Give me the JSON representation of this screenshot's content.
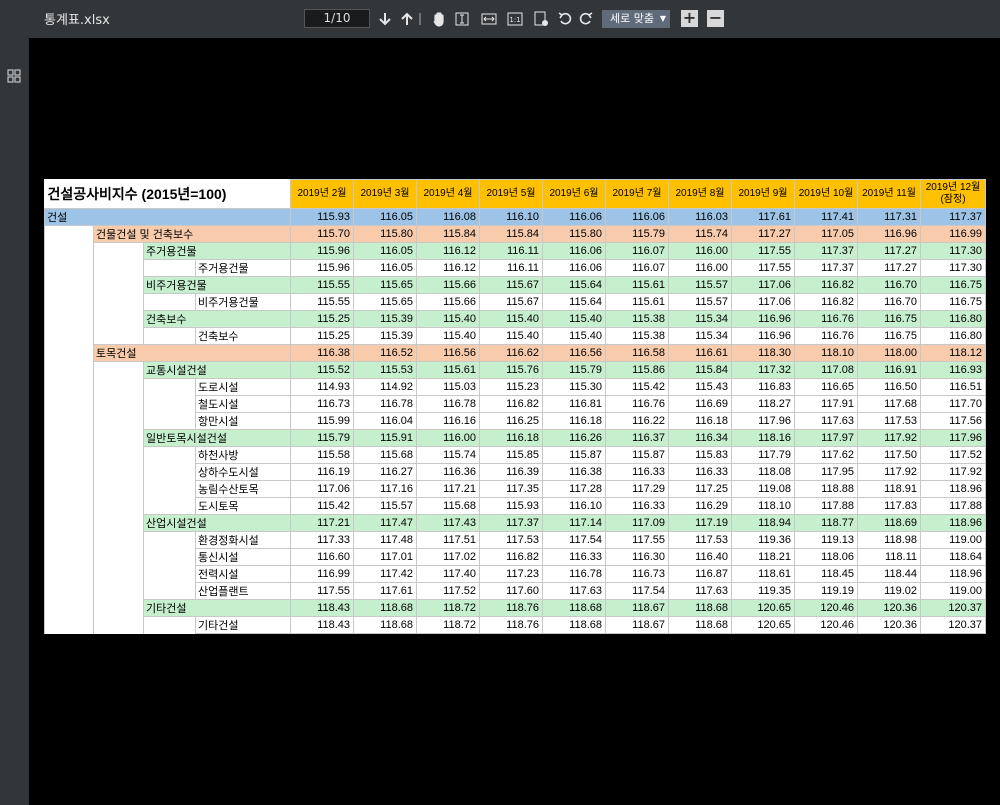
{
  "app": {
    "file_name": "통계표.xlsx",
    "page_indicator": "1/10",
    "fit_mode": "세로 맞춤",
    "zoom_in": "+",
    "zoom_out": "−"
  },
  "table": {
    "title": "건설공사비지수 (2015년=100)",
    "headers": [
      "2019년 2월",
      "2019년 3월",
      "2019년 4월",
      "2019년 5월",
      "2019년 6월",
      "2019년 7월",
      "2019년 8월",
      "2019년 9월",
      "2019년 10월",
      "2019년 11월",
      "2019년 12월",
      "(잠정)"
    ],
    "rows": [
      {
        "level": 0,
        "label": "건설",
        "values": [
          "115.93",
          "116.05",
          "116.08",
          "116.10",
          "116.06",
          "116.06",
          "116.03",
          "117.61",
          "117.41",
          "117.31",
          "117.37"
        ]
      },
      {
        "level": 1,
        "label": "건물건설 및 건축보수",
        "values": [
          "115.70",
          "115.80",
          "115.84",
          "115.84",
          "115.80",
          "115.79",
          "115.74",
          "117.27",
          "117.05",
          "116.96",
          "116.99"
        ]
      },
      {
        "level": 2,
        "label": "주거용건물",
        "values": [
          "115.96",
          "116.05",
          "116.12",
          "116.11",
          "116.06",
          "116.07",
          "116.00",
          "117.55",
          "117.37",
          "117.27",
          "117.30"
        ]
      },
      {
        "level": 3,
        "label": "주거용건물",
        "values": [
          "115.96",
          "116.05",
          "116.12",
          "116.11",
          "116.06",
          "116.07",
          "116.00",
          "117.55",
          "117.37",
          "117.27",
          "117.30"
        ]
      },
      {
        "level": 2,
        "label": "비주거용건물",
        "values": [
          "115.55",
          "115.65",
          "115.66",
          "115.67",
          "115.64",
          "115.61",
          "115.57",
          "117.06",
          "116.82",
          "116.70",
          "116.75"
        ]
      },
      {
        "level": 3,
        "label": "비주거용건물",
        "values": [
          "115.55",
          "115.65",
          "115.66",
          "115.67",
          "115.64",
          "115.61",
          "115.57",
          "117.06",
          "116.82",
          "116.70",
          "116.75"
        ]
      },
      {
        "level": 2,
        "label": "건축보수",
        "values": [
          "115.25",
          "115.39",
          "115.40",
          "115.40",
          "115.40",
          "115.38",
          "115.34",
          "116.96",
          "116.76",
          "116.75",
          "116.80"
        ]
      },
      {
        "level": 3,
        "label": "건축보수",
        "values": [
          "115.25",
          "115.39",
          "115.40",
          "115.40",
          "115.40",
          "115.38",
          "115.34",
          "116.96",
          "116.76",
          "116.75",
          "116.80"
        ]
      },
      {
        "level": 1,
        "label": "토목건설",
        "values": [
          "116.38",
          "116.52",
          "116.56",
          "116.62",
          "116.56",
          "116.58",
          "116.61",
          "118.30",
          "118.10",
          "118.00",
          "118.12"
        ]
      },
      {
        "level": 2,
        "label": "교통시설건설",
        "values": [
          "115.52",
          "115.53",
          "115.61",
          "115.76",
          "115.79",
          "115.86",
          "115.84",
          "117.32",
          "117.08",
          "116.91",
          "116.93"
        ]
      },
      {
        "level": 3,
        "label": "도로시설",
        "values": [
          "114.93",
          "114.92",
          "115.03",
          "115.23",
          "115.30",
          "115.42",
          "115.43",
          "116.83",
          "116.65",
          "116.50",
          "116.51"
        ]
      },
      {
        "level": 3,
        "label": "철도시설",
        "values": [
          "116.73",
          "116.78",
          "116.78",
          "116.82",
          "116.81",
          "116.76",
          "116.69",
          "118.27",
          "117.91",
          "117.68",
          "117.70"
        ]
      },
      {
        "level": 3,
        "label": "항만시설",
        "values": [
          "115.99",
          "116.04",
          "116.16",
          "116.25",
          "116.18",
          "116.22",
          "116.18",
          "117.96",
          "117.63",
          "117.53",
          "117.56"
        ]
      },
      {
        "level": 2,
        "label": "일반토목시설건설",
        "values": [
          "115.79",
          "115.91",
          "116.00",
          "116.18",
          "116.26",
          "116.37",
          "116.34",
          "118.16",
          "117.97",
          "117.92",
          "117.96"
        ]
      },
      {
        "level": 3,
        "label": "하천사방",
        "values": [
          "115.58",
          "115.68",
          "115.74",
          "115.85",
          "115.87",
          "115.87",
          "115.83",
          "117.79",
          "117.62",
          "117.50",
          "117.52"
        ]
      },
      {
        "level": 3,
        "label": "상하수도시설",
        "values": [
          "116.19",
          "116.27",
          "116.36",
          "116.39",
          "116.38",
          "116.33",
          "116.33",
          "118.08",
          "117.95",
          "117.92",
          "117.92"
        ]
      },
      {
        "level": 3,
        "label": "농림수산토목",
        "values": [
          "117.06",
          "117.16",
          "117.21",
          "117.35",
          "117.28",
          "117.29",
          "117.25",
          "119.08",
          "118.88",
          "118.91",
          "118.96"
        ]
      },
      {
        "level": 3,
        "label": "도시토목",
        "values": [
          "115.42",
          "115.57",
          "115.68",
          "115.93",
          "116.10",
          "116.33",
          "116.29",
          "118.10",
          "117.88",
          "117.83",
          "117.88"
        ]
      },
      {
        "level": 2,
        "label": "산업시설건설",
        "values": [
          "117.21",
          "117.47",
          "117.43",
          "117.37",
          "117.14",
          "117.09",
          "117.19",
          "118.94",
          "118.77",
          "118.69",
          "118.96"
        ]
      },
      {
        "level": 3,
        "label": "환경정화시설",
        "values": [
          "117.33",
          "117.48",
          "117.51",
          "117.53",
          "117.54",
          "117.55",
          "117.53",
          "119.36",
          "119.13",
          "118.98",
          "119.00"
        ]
      },
      {
        "level": 3,
        "label": "통신시설",
        "values": [
          "116.60",
          "117.01",
          "117.02",
          "116.82",
          "116.33",
          "116.30",
          "116.40",
          "118.21",
          "118.06",
          "118.11",
          "118.64"
        ]
      },
      {
        "level": 3,
        "label": "전력시설",
        "values": [
          "116.99",
          "117.42",
          "117.40",
          "117.23",
          "116.78",
          "116.73",
          "116.87",
          "118.61",
          "118.45",
          "118.44",
          "118.96"
        ]
      },
      {
        "level": 3,
        "label": "산업플랜트",
        "values": [
          "117.55",
          "117.61",
          "117.52",
          "117.60",
          "117.63",
          "117.54",
          "117.63",
          "119.35",
          "119.19",
          "119.02",
          "119.00"
        ]
      },
      {
        "level": 2,
        "label": "기타건설",
        "values": [
          "118.43",
          "118.68",
          "118.72",
          "118.76",
          "118.68",
          "118.67",
          "118.68",
          "120.65",
          "120.46",
          "120.36",
          "120.37"
        ]
      },
      {
        "level": 3,
        "label": "기타건설",
        "values": [
          "118.43",
          "118.68",
          "118.72",
          "118.76",
          "118.68",
          "118.67",
          "118.68",
          "120.65",
          "120.46",
          "120.36",
          "120.37"
        ]
      }
    ]
  }
}
